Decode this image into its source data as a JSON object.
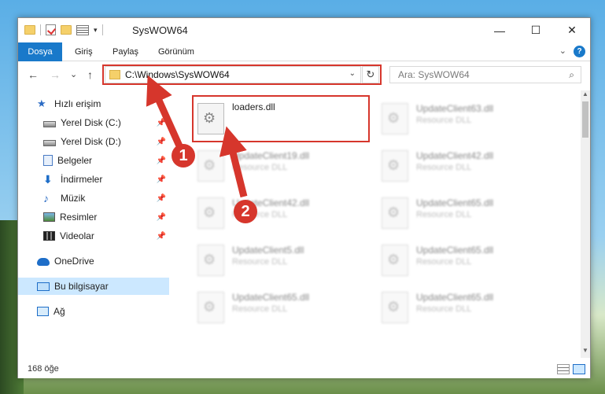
{
  "window": {
    "title": "SysWOW64",
    "minimize_glyph": "—",
    "maximize_glyph": "☐",
    "close_glyph": "✕"
  },
  "ribbon": {
    "tabs": [
      {
        "label": "Dosya"
      },
      {
        "label": "Giriş"
      },
      {
        "label": "Paylaş"
      },
      {
        "label": "Görünüm"
      }
    ],
    "help_glyph": "?"
  },
  "nav": {
    "back_glyph": "←",
    "forward_glyph": "→",
    "recent_glyph": "⌄",
    "up_glyph": "↑",
    "address": "C:\\Windows\\SysWOW64",
    "refresh_glyph": "↻",
    "search_placeholder": "Ara: SysWOW64"
  },
  "sidebar": {
    "items": [
      {
        "label": "Hızlı erişim",
        "icon": "star-icon"
      },
      {
        "label": "Yerel Disk (C:)",
        "icon": "disk-icon"
      },
      {
        "label": "Yerel Disk (D:)",
        "icon": "disk-icon"
      },
      {
        "label": "Belgeler",
        "icon": "documents-icon"
      },
      {
        "label": "İndirmeler",
        "icon": "downloads-icon"
      },
      {
        "label": "Müzik",
        "icon": "music-icon"
      },
      {
        "label": "Resimler",
        "icon": "pictures-icon"
      },
      {
        "label": "Videolar",
        "icon": "videos-icon"
      },
      {
        "label": "OneDrive",
        "icon": "onedrive-icon"
      },
      {
        "label": "Bu bilgisayar",
        "icon": "this-pc-icon"
      },
      {
        "label": "Ağ",
        "icon": "network-icon"
      }
    ]
  },
  "files": {
    "highlighted": {
      "name": "loaders.dll"
    },
    "others": [
      {
        "name": "UpdateClient63.dll",
        "type": "Resource DLL"
      },
      {
        "name": "UpdateClient19.dll",
        "type": "Resource DLL"
      },
      {
        "name": "UpdateClient42.dll",
        "type": "Resource DLL"
      },
      {
        "name": "UpdateClient42.dll",
        "type": "Resource DLL"
      },
      {
        "name": "UpdateClient65.dll",
        "type": "Resource DLL"
      },
      {
        "name": "UpdateClient5.dll",
        "type": "Resource DLL"
      },
      {
        "name": "UpdateClient65.dll",
        "type": "Resource DLL"
      },
      {
        "name": "UpdateClient65.dll",
        "type": "Resource DLL"
      },
      {
        "name": "UpdateClient65.dll",
        "type": "Resource DLL"
      }
    ]
  },
  "status": {
    "count": "168 öğe"
  },
  "annotations": {
    "step1": "1",
    "step2": "2",
    "color": "#d6362c"
  }
}
